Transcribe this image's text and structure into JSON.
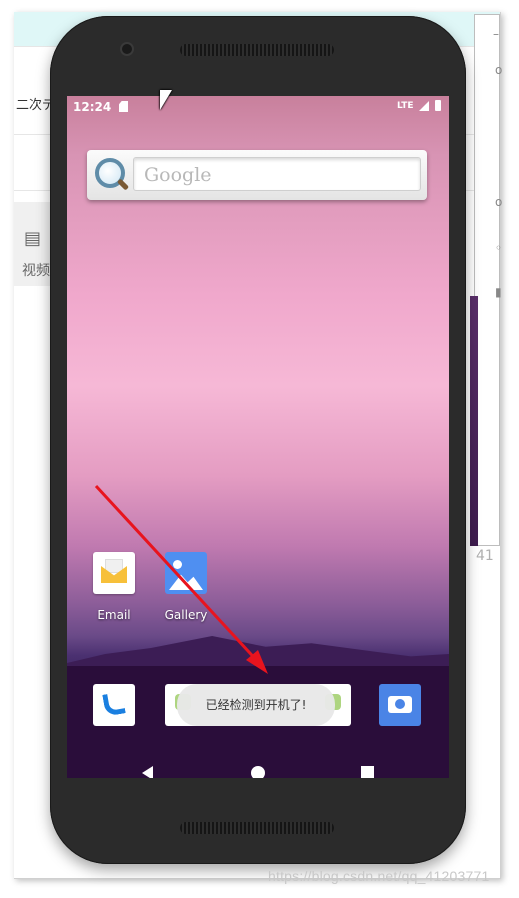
{
  "desktop": {
    "fragment_text": "二次デ",
    "video_tab_label": "视频",
    "side_number": "41",
    "watermark": "https://blog.csdn.net/qq_41203771"
  },
  "phone": {
    "status": {
      "time": "12:24",
      "network": "LTE"
    },
    "search": {
      "placeholder": "Google"
    },
    "apps": [
      {
        "label": "Email",
        "icon": "email-icon"
      },
      {
        "label": "Gallery",
        "icon": "gallery-icon"
      }
    ],
    "dock": [
      "phone-icon",
      "apps-icon",
      "camera-icon"
    ],
    "toast": "已经检测到开机了!",
    "nav": [
      "back-icon",
      "home-icon",
      "recents-icon"
    ]
  },
  "colors": {
    "annotation_arrow": "#e8141e",
    "accent_blue": "#4a84e6"
  }
}
